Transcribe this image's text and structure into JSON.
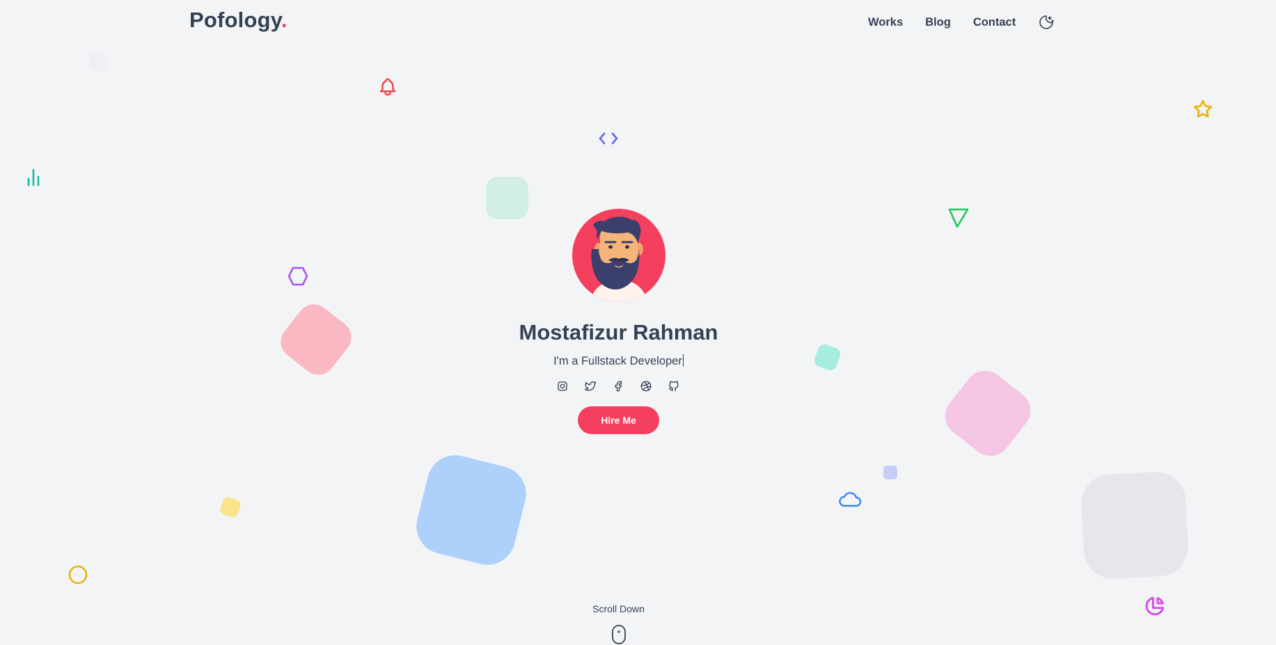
{
  "header": {
    "logo_text": "Pofology",
    "logo_dot": ".",
    "nav": [
      "Works",
      "Blog",
      "Contact"
    ],
    "theme_toggle_icon": "moon-stars-icon"
  },
  "hero": {
    "name": "Mostafizur Rahman",
    "role": "I'm a Fullstack Developer",
    "avatar_icon": "bearded-man-avatar",
    "socials": [
      "instagram-icon",
      "twitter-icon",
      "facebook-icon",
      "dribbble-icon",
      "github-icon"
    ],
    "cta_label": "Hire Me"
  },
  "scroll": {
    "label": "Scroll Down",
    "icon": "mouse-icon"
  },
  "colors": {
    "accent": "#f43f5e",
    "text": "#334155",
    "background": "#f3f4f6"
  }
}
